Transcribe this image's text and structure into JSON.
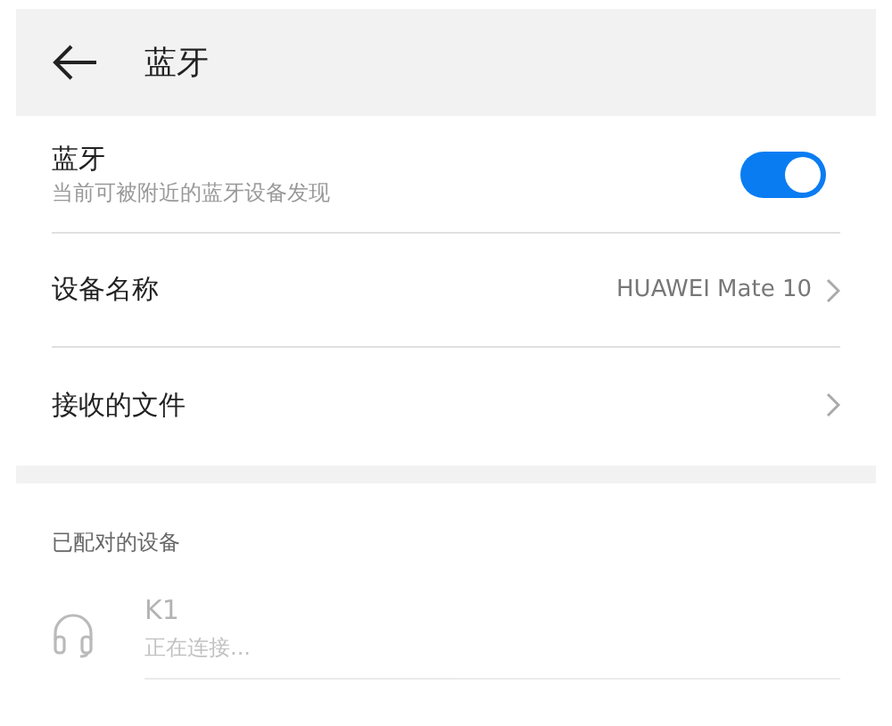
{
  "header": {
    "title": "蓝牙"
  },
  "bluetooth": {
    "label": "蓝牙",
    "subtitle": "当前可被附近的蓝牙设备发现",
    "on": true
  },
  "rows": [
    {
      "label": "设备名称",
      "value": "HUAWEI Mate 10"
    },
    {
      "label": "接收的文件"
    }
  ],
  "paired": {
    "heading": "已配对的设备",
    "devices": [
      {
        "name": "K1",
        "status": "正在连接...",
        "disabled": true
      }
    ]
  }
}
